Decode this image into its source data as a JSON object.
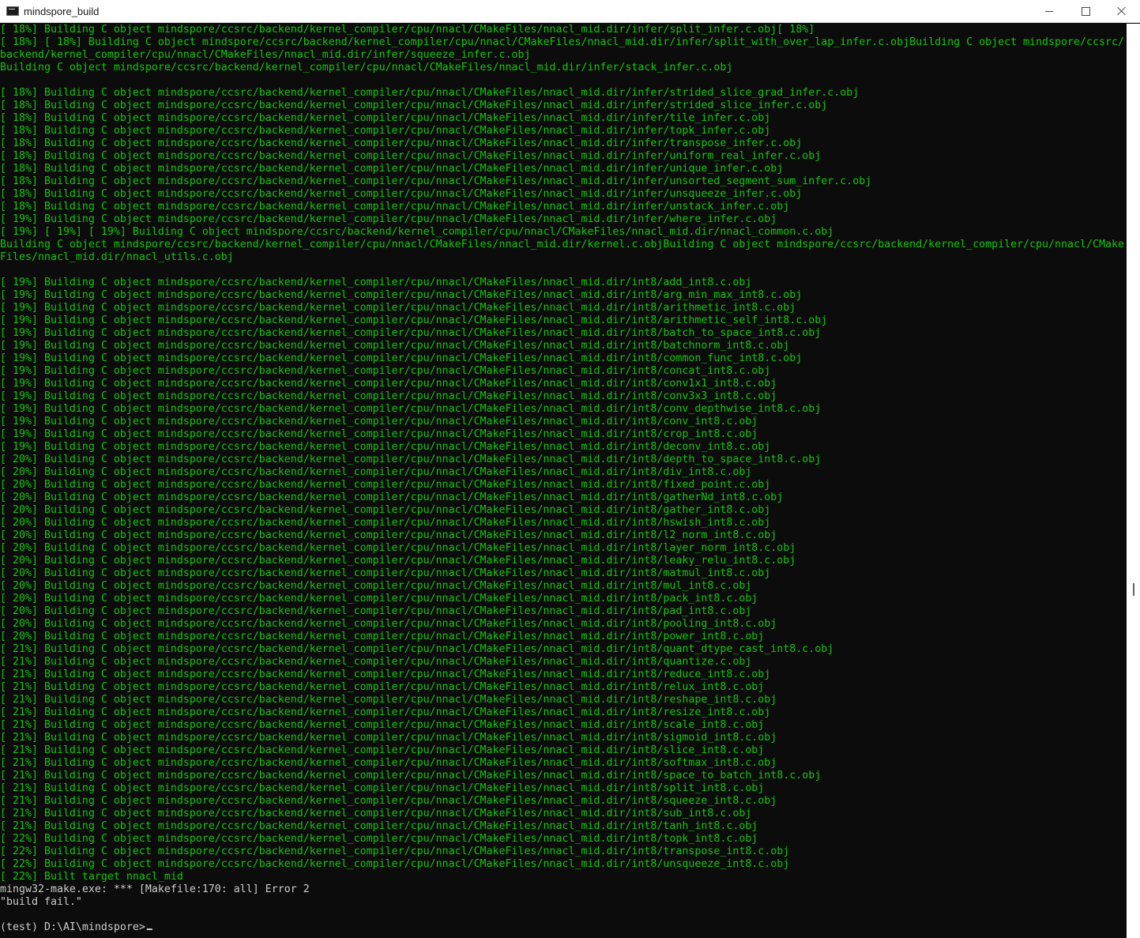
{
  "window": {
    "title": "mindspore_build",
    "terminal_icon": "terminal-icon",
    "controls": {
      "minimize_icon": "minimize-icon",
      "maximize_icon": "maximize-icon",
      "close_icon": "close-icon"
    }
  },
  "colors": {
    "output_green": "#16c60c",
    "text_gray": "#cccccc",
    "background": "#0c0c0c"
  },
  "console": {
    "lines": [
      "[ 18%] Building C object mindspore/ccsrc/backend/kernel_compiler/cpu/nnacl/CMakeFiles/nnacl_mid.dir/infer/split_infer.c.obj[ 18%]",
      "[ 18%] [ 18%] Building C object mindspore/ccsrc/backend/kernel_compiler/cpu/nnacl/CMakeFiles/nnacl_mid.dir/infer/split_with_over_lap_infer.c.objBuilding C object mindspore/ccsrc/",
      "backend/kernel_compiler/cpu/nnacl/CMakeFiles/nnacl_mid.dir/infer/squeeze_infer.c.obj",
      "Building C object mindspore/ccsrc/backend/kernel_compiler/cpu/nnacl/CMakeFiles/nnacl_mid.dir/infer/stack_infer.c.obj",
      "",
      "[ 18%] Building C object mindspore/ccsrc/backend/kernel_compiler/cpu/nnacl/CMakeFiles/nnacl_mid.dir/infer/strided_slice_grad_infer.c.obj",
      "[ 18%] Building C object mindspore/ccsrc/backend/kernel_compiler/cpu/nnacl/CMakeFiles/nnacl_mid.dir/infer/strided_slice_infer.c.obj",
      "[ 18%] Building C object mindspore/ccsrc/backend/kernel_compiler/cpu/nnacl/CMakeFiles/nnacl_mid.dir/infer/tile_infer.c.obj",
      "[ 18%] Building C object mindspore/ccsrc/backend/kernel_compiler/cpu/nnacl/CMakeFiles/nnacl_mid.dir/infer/topk_infer.c.obj",
      "[ 18%] Building C object mindspore/ccsrc/backend/kernel_compiler/cpu/nnacl/CMakeFiles/nnacl_mid.dir/infer/transpose_infer.c.obj",
      "[ 18%] Building C object mindspore/ccsrc/backend/kernel_compiler/cpu/nnacl/CMakeFiles/nnacl_mid.dir/infer/uniform_real_infer.c.obj",
      "[ 18%] Building C object mindspore/ccsrc/backend/kernel_compiler/cpu/nnacl/CMakeFiles/nnacl_mid.dir/infer/unique_infer.c.obj",
      "[ 18%] Building C object mindspore/ccsrc/backend/kernel_compiler/cpu/nnacl/CMakeFiles/nnacl_mid.dir/infer/unsorted_segment_sum_infer.c.obj",
      "[ 18%] Building C object mindspore/ccsrc/backend/kernel_compiler/cpu/nnacl/CMakeFiles/nnacl_mid.dir/infer/unsqueeze_infer.c.obj",
      "[ 18%] Building C object mindspore/ccsrc/backend/kernel_compiler/cpu/nnacl/CMakeFiles/nnacl_mid.dir/infer/unstack_infer.c.obj",
      "[ 19%] Building C object mindspore/ccsrc/backend/kernel_compiler/cpu/nnacl/CMakeFiles/nnacl_mid.dir/infer/where_infer.c.obj",
      "[ 19%] [ 19%] [ 19%] Building C object mindspore/ccsrc/backend/kernel_compiler/cpu/nnacl/CMakeFiles/nnacl_mid.dir/nnacl_common.c.obj",
      "Building C object mindspore/ccsrc/backend/kernel_compiler/cpu/nnacl/CMakeFiles/nnacl_mid.dir/kernel.c.objBuilding C object mindspore/ccsrc/backend/kernel_compiler/cpu/nnacl/CMake",
      "Files/nnacl_mid.dir/nnacl_utils.c.obj",
      "",
      "[ 19%] Building C object mindspore/ccsrc/backend/kernel_compiler/cpu/nnacl/CMakeFiles/nnacl_mid.dir/int8/add_int8.c.obj",
      "[ 19%] Building C object mindspore/ccsrc/backend/kernel_compiler/cpu/nnacl/CMakeFiles/nnacl_mid.dir/int8/arg_min_max_int8.c.obj",
      "[ 19%] Building C object mindspore/ccsrc/backend/kernel_compiler/cpu/nnacl/CMakeFiles/nnacl_mid.dir/int8/arithmetic_int8.c.obj",
      "[ 19%] Building C object mindspore/ccsrc/backend/kernel_compiler/cpu/nnacl/CMakeFiles/nnacl_mid.dir/int8/arithmetic_self_int8.c.obj",
      "[ 19%] Building C object mindspore/ccsrc/backend/kernel_compiler/cpu/nnacl/CMakeFiles/nnacl_mid.dir/int8/batch_to_space_int8.c.obj",
      "[ 19%] Building C object mindspore/ccsrc/backend/kernel_compiler/cpu/nnacl/CMakeFiles/nnacl_mid.dir/int8/batchnorm_int8.c.obj",
      "[ 19%] Building C object mindspore/ccsrc/backend/kernel_compiler/cpu/nnacl/CMakeFiles/nnacl_mid.dir/int8/common_func_int8.c.obj",
      "[ 19%] Building C object mindspore/ccsrc/backend/kernel_compiler/cpu/nnacl/CMakeFiles/nnacl_mid.dir/int8/concat_int8.c.obj",
      "[ 19%] Building C object mindspore/ccsrc/backend/kernel_compiler/cpu/nnacl/CMakeFiles/nnacl_mid.dir/int8/conv1x1_int8.c.obj",
      "[ 19%] Building C object mindspore/ccsrc/backend/kernel_compiler/cpu/nnacl/CMakeFiles/nnacl_mid.dir/int8/conv3x3_int8.c.obj",
      "[ 19%] Building C object mindspore/ccsrc/backend/kernel_compiler/cpu/nnacl/CMakeFiles/nnacl_mid.dir/int8/conv_depthwise_int8.c.obj",
      "[ 19%] Building C object mindspore/ccsrc/backend/kernel_compiler/cpu/nnacl/CMakeFiles/nnacl_mid.dir/int8/conv_int8.c.obj",
      "[ 19%] Building C object mindspore/ccsrc/backend/kernel_compiler/cpu/nnacl/CMakeFiles/nnacl_mid.dir/int8/crop_int8.c.obj",
      "[ 19%] Building C object mindspore/ccsrc/backend/kernel_compiler/cpu/nnacl/CMakeFiles/nnacl_mid.dir/int8/deconv_int8.c.obj",
      "[ 20%] Building C object mindspore/ccsrc/backend/kernel_compiler/cpu/nnacl/CMakeFiles/nnacl_mid.dir/int8/depth_to_space_int8.c.obj",
      "[ 20%] Building C object mindspore/ccsrc/backend/kernel_compiler/cpu/nnacl/CMakeFiles/nnacl_mid.dir/int8/div_int8.c.obj",
      "[ 20%] Building C object mindspore/ccsrc/backend/kernel_compiler/cpu/nnacl/CMakeFiles/nnacl_mid.dir/int8/fixed_point.c.obj",
      "[ 20%] Building C object mindspore/ccsrc/backend/kernel_compiler/cpu/nnacl/CMakeFiles/nnacl_mid.dir/int8/gatherNd_int8.c.obj",
      "[ 20%] Building C object mindspore/ccsrc/backend/kernel_compiler/cpu/nnacl/CMakeFiles/nnacl_mid.dir/int8/gather_int8.c.obj",
      "[ 20%] Building C object mindspore/ccsrc/backend/kernel_compiler/cpu/nnacl/CMakeFiles/nnacl_mid.dir/int8/hswish_int8.c.obj",
      "[ 20%] Building C object mindspore/ccsrc/backend/kernel_compiler/cpu/nnacl/CMakeFiles/nnacl_mid.dir/int8/l2_norm_int8.c.obj",
      "[ 20%] Building C object mindspore/ccsrc/backend/kernel_compiler/cpu/nnacl/CMakeFiles/nnacl_mid.dir/int8/layer_norm_int8.c.obj",
      "[ 20%] Building C object mindspore/ccsrc/backend/kernel_compiler/cpu/nnacl/CMakeFiles/nnacl_mid.dir/int8/leaky_relu_int8.c.obj",
      "[ 20%] Building C object mindspore/ccsrc/backend/kernel_compiler/cpu/nnacl/CMakeFiles/nnacl_mid.dir/int8/matmul_int8.c.obj",
      "[ 20%] Building C object mindspore/ccsrc/backend/kernel_compiler/cpu/nnacl/CMakeFiles/nnacl_mid.dir/int8/mul_int8.c.obj",
      "[ 20%] Building C object mindspore/ccsrc/backend/kernel_compiler/cpu/nnacl/CMakeFiles/nnacl_mid.dir/int8/pack_int8.c.obj",
      "[ 20%] Building C object mindspore/ccsrc/backend/kernel_compiler/cpu/nnacl/CMakeFiles/nnacl_mid.dir/int8/pad_int8.c.obj",
      "[ 20%] Building C object mindspore/ccsrc/backend/kernel_compiler/cpu/nnacl/CMakeFiles/nnacl_mid.dir/int8/pooling_int8.c.obj",
      "[ 20%] Building C object mindspore/ccsrc/backend/kernel_compiler/cpu/nnacl/CMakeFiles/nnacl_mid.dir/int8/power_int8.c.obj",
      "[ 21%] Building C object mindspore/ccsrc/backend/kernel_compiler/cpu/nnacl/CMakeFiles/nnacl_mid.dir/int8/quant_dtype_cast_int8.c.obj",
      "[ 21%] Building C object mindspore/ccsrc/backend/kernel_compiler/cpu/nnacl/CMakeFiles/nnacl_mid.dir/int8/quantize.c.obj",
      "[ 21%] Building C object mindspore/ccsrc/backend/kernel_compiler/cpu/nnacl/CMakeFiles/nnacl_mid.dir/int8/reduce_int8.c.obj",
      "[ 21%] Building C object mindspore/ccsrc/backend/kernel_compiler/cpu/nnacl/CMakeFiles/nnacl_mid.dir/int8/relux_int8.c.obj",
      "[ 21%] Building C object mindspore/ccsrc/backend/kernel_compiler/cpu/nnacl/CMakeFiles/nnacl_mid.dir/int8/reshape_int8.c.obj",
      "[ 21%] Building C object mindspore/ccsrc/backend/kernel_compiler/cpu/nnacl/CMakeFiles/nnacl_mid.dir/int8/resize_int8.c.obj",
      "[ 21%] Building C object mindspore/ccsrc/backend/kernel_compiler/cpu/nnacl/CMakeFiles/nnacl_mid.dir/int8/scale_int8.c.obj",
      "[ 21%] Building C object mindspore/ccsrc/backend/kernel_compiler/cpu/nnacl/CMakeFiles/nnacl_mid.dir/int8/sigmoid_int8.c.obj",
      "[ 21%] Building C object mindspore/ccsrc/backend/kernel_compiler/cpu/nnacl/CMakeFiles/nnacl_mid.dir/int8/slice_int8.c.obj",
      "[ 21%] Building C object mindspore/ccsrc/backend/kernel_compiler/cpu/nnacl/CMakeFiles/nnacl_mid.dir/int8/softmax_int8.c.obj",
      "[ 21%] Building C object mindspore/ccsrc/backend/kernel_compiler/cpu/nnacl/CMakeFiles/nnacl_mid.dir/int8/space_to_batch_int8.c.obj",
      "[ 21%] Building C object mindspore/ccsrc/backend/kernel_compiler/cpu/nnacl/CMakeFiles/nnacl_mid.dir/int8/split_int8.c.obj",
      "[ 21%] Building C object mindspore/ccsrc/backend/kernel_compiler/cpu/nnacl/CMakeFiles/nnacl_mid.dir/int8/squeeze_int8.c.obj",
      "[ 21%] Building C object mindspore/ccsrc/backend/kernel_compiler/cpu/nnacl/CMakeFiles/nnacl_mid.dir/int8/sub_int8.c.obj",
      "[ 21%] Building C object mindspore/ccsrc/backend/kernel_compiler/cpu/nnacl/CMakeFiles/nnacl_mid.dir/int8/tanh_int8.c.obj",
      "[ 22%] Building C object mindspore/ccsrc/backend/kernel_compiler/cpu/nnacl/CMakeFiles/nnacl_mid.dir/int8/topk_int8.c.obj",
      "[ 22%] Building C object mindspore/ccsrc/backend/kernel_compiler/cpu/nnacl/CMakeFiles/nnacl_mid.dir/int8/transpose_int8.c.obj",
      "[ 22%] Building C object mindspore/ccsrc/backend/kernel_compiler/cpu/nnacl/CMakeFiles/nnacl_mid.dir/int8/unsqueeze_int8.c.obj",
      "[ 22%] Built target nnacl_mid"
    ],
    "error_lines": [
      "mingw32-make.exe: *** [Makefile:170: all] Error 2",
      "\"build fail.\"",
      ""
    ],
    "prompt": "(test) D:\\AI\\mindspore>"
  }
}
